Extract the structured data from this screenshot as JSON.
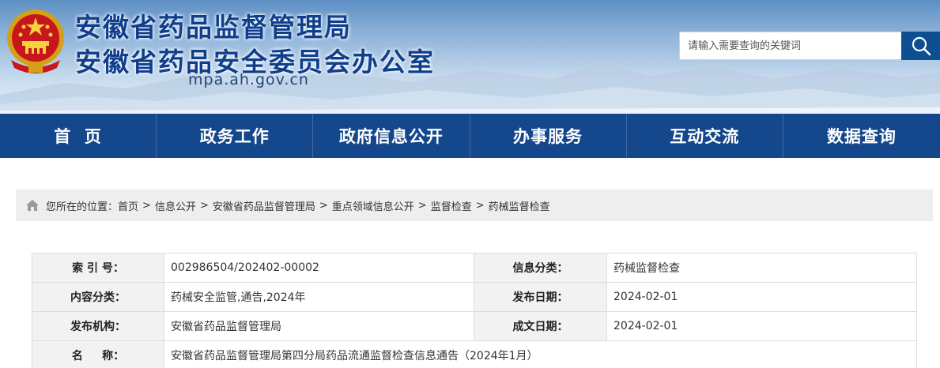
{
  "header": {
    "title_main": "安徽省药品监督管理局",
    "title_sub": "安徽省药品安全委员会办公室",
    "domain": "mpa.ah.gov.cn",
    "search_placeholder": "请输入需要查询的关键词"
  },
  "icons": {
    "emblem": "national-emblem-icon",
    "search": "search-icon",
    "home": "home-icon"
  },
  "colors": {
    "nav_background": "#14478b",
    "title_text": "#0f3e8c",
    "search_button": "#0d4f91"
  },
  "nav": {
    "items": [
      {
        "label": "首  页"
      },
      {
        "label": "政务工作"
      },
      {
        "label": "政府信息公开"
      },
      {
        "label": "办事服务"
      },
      {
        "label": "互动交流"
      },
      {
        "label": "数据查询"
      }
    ]
  },
  "breadcrumb": {
    "prefix": "您所在的位置：",
    "items": [
      "首页",
      "信息公开",
      "安徽省药品监督管理局",
      "重点领域信息公开",
      "监督检查",
      "药械监督检查"
    ],
    "separator": ">"
  },
  "info_table": {
    "rows": [
      {
        "label1": "索 引 号：",
        "value1": "002986504/202402-00002",
        "label2": "信息分类：",
        "value2": "药械监督检查"
      },
      {
        "label1": "内容分类：",
        "value1": "药械安全监管,通告,2024年",
        "label2": "发布日期：",
        "value2": "2024-02-01"
      },
      {
        "label1": "发布机构：",
        "value1": "安徽省药品监督管理局",
        "label2": "成文日期：",
        "value2": "2024-02-01"
      }
    ],
    "name_row": {
      "label": "名     称：",
      "value": "安徽省药品监督管理局第四分局药品流通监督检查信息通告（2024年1月）"
    }
  }
}
